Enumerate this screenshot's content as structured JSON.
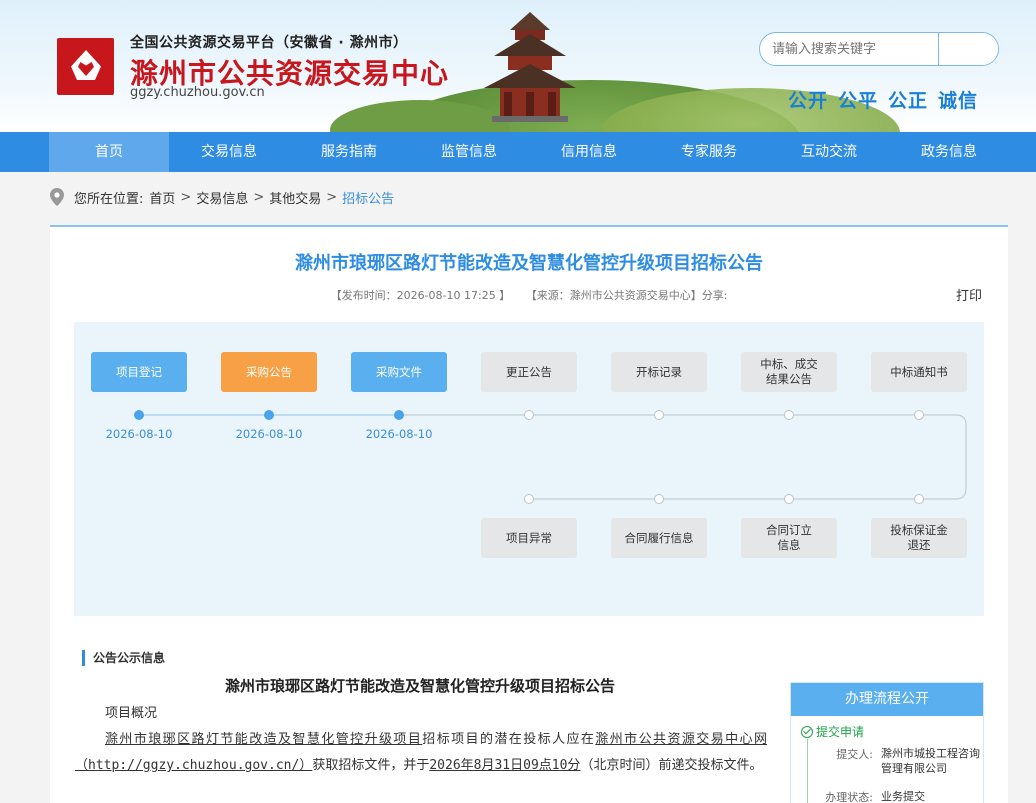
{
  "header": {
    "subtitle": "全国公共资源交易平台（安徽省 · 滁州市）",
    "title": "滁州市公共资源交易中心",
    "url": "ggzy.chuzhou.gov.cn",
    "search_placeholder": "请输入搜索关键字",
    "slogan": [
      "公开",
      "公平",
      "公正",
      "诚信"
    ]
  },
  "nav": [
    "首页",
    "交易信息",
    "服务指南",
    "监管信息",
    "信用信息",
    "专家服务",
    "互动交流",
    "政务信息"
  ],
  "breadcrumb": {
    "label": "您所在位置:",
    "items": [
      "首页",
      "交易信息",
      "其他交易"
    ],
    "current": "招标公告"
  },
  "article": {
    "title": "滁州市琅琊区路灯节能改造及智慧化管控升级项目招标公告",
    "publish_time": "【发布时间：2026-08-10 17:25 】",
    "source": "【来源：滁州市公共资源交易中心】分享:",
    "print": "打印"
  },
  "flow": {
    "top": [
      {
        "label": "项目登记",
        "state": "done",
        "date": "2026-08-10"
      },
      {
        "label": "采购公告",
        "state": "current",
        "date": "2026-08-10"
      },
      {
        "label": "采购文件",
        "state": "done",
        "date": "2026-08-10"
      },
      {
        "label": "更正公告",
        "state": "pending",
        "date": ""
      },
      {
        "label": "开标记录",
        "state": "pending",
        "date": ""
      },
      {
        "label": "中标、成交\n结果公告",
        "state": "pending",
        "date": ""
      },
      {
        "label": "中标通知书",
        "state": "pending",
        "date": ""
      }
    ],
    "bottom": [
      {
        "label": "项目异常"
      },
      {
        "label": "合同履行信息"
      },
      {
        "label": "合同订立\n信息"
      },
      {
        "label": "投标保证金\n退还"
      }
    ]
  },
  "notice": {
    "section_label": "公告公示信息",
    "title": "滁州市琅琊区路灯节能改造及智慧化管控升级项目招标公告",
    "overview_label": "项目概况",
    "p1_project": "滁州市琅琊区路灯节能改造及智慧化管控升级项目",
    "p1_mid": "招标项目的潜在投标人应在",
    "p1_site": "滁州市公共资源交易中心网（http://ggzy.chuzhou.gov.cn/）",
    "p1_mid2": "获取招标文件，并于",
    "p1_deadline": "2026年8月31日09点10分",
    "p1_end": "（北京时间）前递交投标文件。"
  },
  "side": {
    "title": "办理流程公开",
    "step": "提交申请",
    "submitter_label": "提交人:",
    "submitter": "滁州市城投工程咨询管理有限公司",
    "status_label": "办理状态:",
    "status": "业务提交"
  },
  "colors": {
    "nav": "#2e8de3",
    "accent": "#2e8de3",
    "brand_red": "#c8161d",
    "current_step": "#f8a045",
    "done_step": "#5aafef"
  }
}
